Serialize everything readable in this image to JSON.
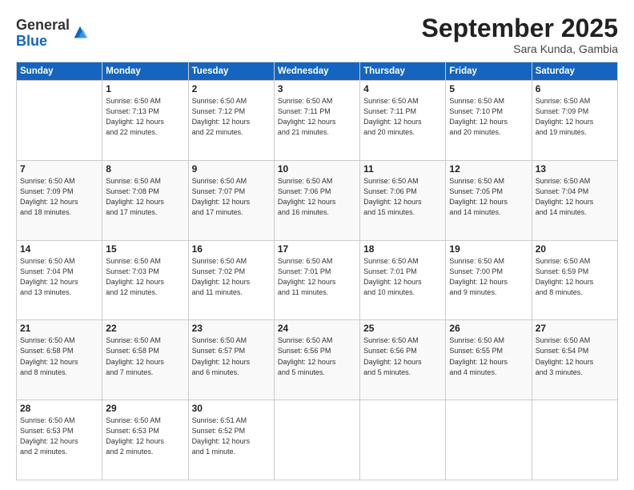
{
  "logo": {
    "general": "General",
    "blue": "Blue"
  },
  "header": {
    "month": "September 2025",
    "location": "Sara Kunda, Gambia"
  },
  "days_of_week": [
    "Sunday",
    "Monday",
    "Tuesday",
    "Wednesday",
    "Thursday",
    "Friday",
    "Saturday"
  ],
  "weeks": [
    [
      {
        "day": "",
        "info": ""
      },
      {
        "day": "1",
        "info": "Sunrise: 6:50 AM\nSunset: 7:13 PM\nDaylight: 12 hours\nand 22 minutes."
      },
      {
        "day": "2",
        "info": "Sunrise: 6:50 AM\nSunset: 7:12 PM\nDaylight: 12 hours\nand 22 minutes."
      },
      {
        "day": "3",
        "info": "Sunrise: 6:50 AM\nSunset: 7:11 PM\nDaylight: 12 hours\nand 21 minutes."
      },
      {
        "day": "4",
        "info": "Sunrise: 6:50 AM\nSunset: 7:11 PM\nDaylight: 12 hours\nand 20 minutes."
      },
      {
        "day": "5",
        "info": "Sunrise: 6:50 AM\nSunset: 7:10 PM\nDaylight: 12 hours\nand 20 minutes."
      },
      {
        "day": "6",
        "info": "Sunrise: 6:50 AM\nSunset: 7:09 PM\nDaylight: 12 hours\nand 19 minutes."
      }
    ],
    [
      {
        "day": "7",
        "info": "Sunrise: 6:50 AM\nSunset: 7:09 PM\nDaylight: 12 hours\nand 18 minutes."
      },
      {
        "day": "8",
        "info": "Sunrise: 6:50 AM\nSunset: 7:08 PM\nDaylight: 12 hours\nand 17 minutes."
      },
      {
        "day": "9",
        "info": "Sunrise: 6:50 AM\nSunset: 7:07 PM\nDaylight: 12 hours\nand 17 minutes."
      },
      {
        "day": "10",
        "info": "Sunrise: 6:50 AM\nSunset: 7:06 PM\nDaylight: 12 hours\nand 16 minutes."
      },
      {
        "day": "11",
        "info": "Sunrise: 6:50 AM\nSunset: 7:06 PM\nDaylight: 12 hours\nand 15 minutes."
      },
      {
        "day": "12",
        "info": "Sunrise: 6:50 AM\nSunset: 7:05 PM\nDaylight: 12 hours\nand 14 minutes."
      },
      {
        "day": "13",
        "info": "Sunrise: 6:50 AM\nSunset: 7:04 PM\nDaylight: 12 hours\nand 14 minutes."
      }
    ],
    [
      {
        "day": "14",
        "info": "Sunrise: 6:50 AM\nSunset: 7:04 PM\nDaylight: 12 hours\nand 13 minutes."
      },
      {
        "day": "15",
        "info": "Sunrise: 6:50 AM\nSunset: 7:03 PM\nDaylight: 12 hours\nand 12 minutes."
      },
      {
        "day": "16",
        "info": "Sunrise: 6:50 AM\nSunset: 7:02 PM\nDaylight: 12 hours\nand 11 minutes."
      },
      {
        "day": "17",
        "info": "Sunrise: 6:50 AM\nSunset: 7:01 PM\nDaylight: 12 hours\nand 11 minutes."
      },
      {
        "day": "18",
        "info": "Sunrise: 6:50 AM\nSunset: 7:01 PM\nDaylight: 12 hours\nand 10 minutes."
      },
      {
        "day": "19",
        "info": "Sunrise: 6:50 AM\nSunset: 7:00 PM\nDaylight: 12 hours\nand 9 minutes."
      },
      {
        "day": "20",
        "info": "Sunrise: 6:50 AM\nSunset: 6:59 PM\nDaylight: 12 hours\nand 8 minutes."
      }
    ],
    [
      {
        "day": "21",
        "info": "Sunrise: 6:50 AM\nSunset: 6:58 PM\nDaylight: 12 hours\nand 8 minutes."
      },
      {
        "day": "22",
        "info": "Sunrise: 6:50 AM\nSunset: 6:58 PM\nDaylight: 12 hours\nand 7 minutes."
      },
      {
        "day": "23",
        "info": "Sunrise: 6:50 AM\nSunset: 6:57 PM\nDaylight: 12 hours\nand 6 minutes."
      },
      {
        "day": "24",
        "info": "Sunrise: 6:50 AM\nSunset: 6:56 PM\nDaylight: 12 hours\nand 5 minutes."
      },
      {
        "day": "25",
        "info": "Sunrise: 6:50 AM\nSunset: 6:56 PM\nDaylight: 12 hours\nand 5 minutes."
      },
      {
        "day": "26",
        "info": "Sunrise: 6:50 AM\nSunset: 6:55 PM\nDaylight: 12 hours\nand 4 minutes."
      },
      {
        "day": "27",
        "info": "Sunrise: 6:50 AM\nSunset: 6:54 PM\nDaylight: 12 hours\nand 3 minutes."
      }
    ],
    [
      {
        "day": "28",
        "info": "Sunrise: 6:50 AM\nSunset: 6:53 PM\nDaylight: 12 hours\nand 2 minutes."
      },
      {
        "day": "29",
        "info": "Sunrise: 6:50 AM\nSunset: 6:53 PM\nDaylight: 12 hours\nand 2 minutes."
      },
      {
        "day": "30",
        "info": "Sunrise: 6:51 AM\nSunset: 6:52 PM\nDaylight: 12 hours\nand 1 minute."
      },
      {
        "day": "",
        "info": ""
      },
      {
        "day": "",
        "info": ""
      },
      {
        "day": "",
        "info": ""
      },
      {
        "day": "",
        "info": ""
      }
    ]
  ]
}
